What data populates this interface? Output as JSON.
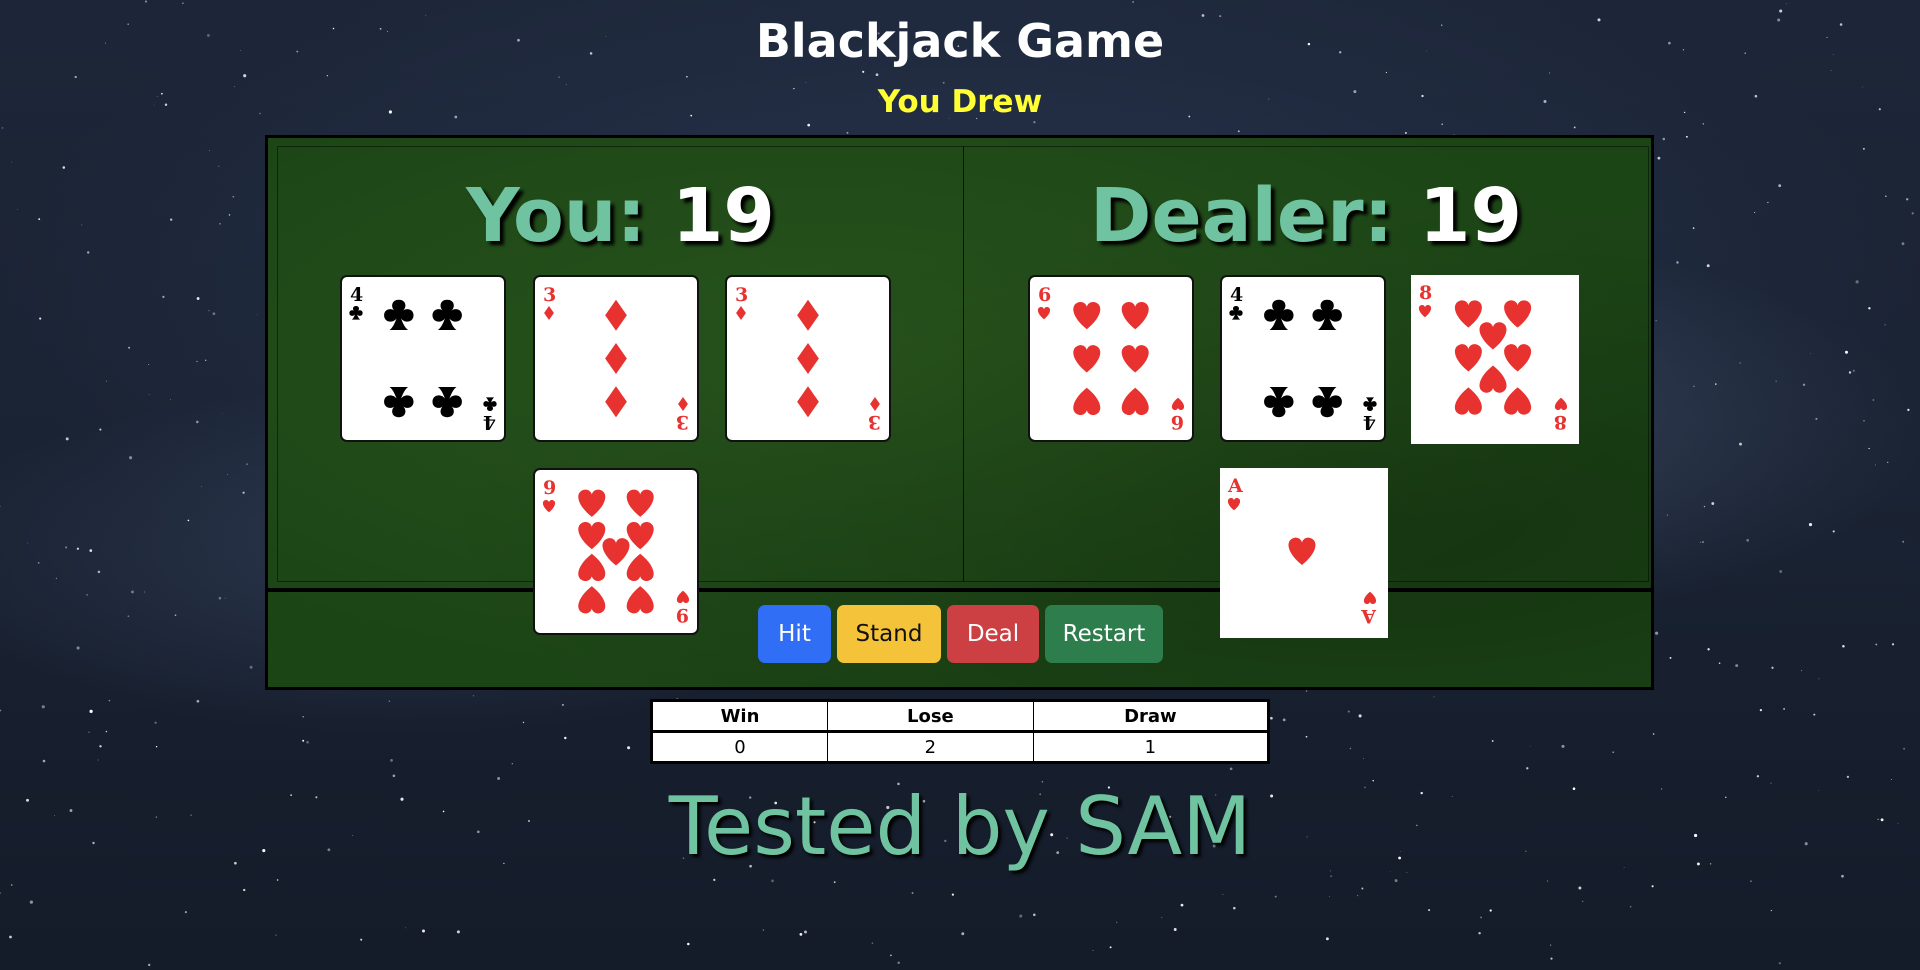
{
  "header": {
    "title": "Blackjack Game",
    "result": "You Drew"
  },
  "player": {
    "label": "You:",
    "score": "19",
    "cards": [
      {
        "rank": "4",
        "suit": "clubs"
      },
      {
        "rank": "3",
        "suit": "diamonds"
      },
      {
        "rank": "3",
        "suit": "diamonds"
      },
      {
        "rank": "9",
        "suit": "hearts"
      }
    ]
  },
  "dealer": {
    "label": "Dealer:",
    "score": "19",
    "cards": [
      {
        "rank": "6",
        "suit": "hearts"
      },
      {
        "rank": "4",
        "suit": "clubs"
      },
      {
        "rank": "8",
        "suit": "hearts"
      },
      {
        "rank": "A",
        "suit": "hearts"
      }
    ]
  },
  "controls": {
    "hit": "Hit",
    "stand": "Stand",
    "deal": "Deal",
    "restart": "Restart"
  },
  "scoreboard": {
    "headers": [
      "Win",
      "Lose",
      "Draw"
    ],
    "values": [
      "0",
      "2",
      "1"
    ]
  },
  "footer": "Tested by SAM",
  "colors": {
    "felt": "#1c4516",
    "score_label": "#6fc3a0",
    "result_text": "#ffff33",
    "hit": "#2f6ef5",
    "stand": "#f5c33a",
    "deal": "#cc3f43",
    "restart": "#2e7d4c",
    "red_suit": "#e8322f",
    "black_suit": "#000000"
  },
  "icons": {
    "clubs": "club-icon",
    "diamonds": "diamond-icon",
    "hearts": "heart-icon"
  }
}
